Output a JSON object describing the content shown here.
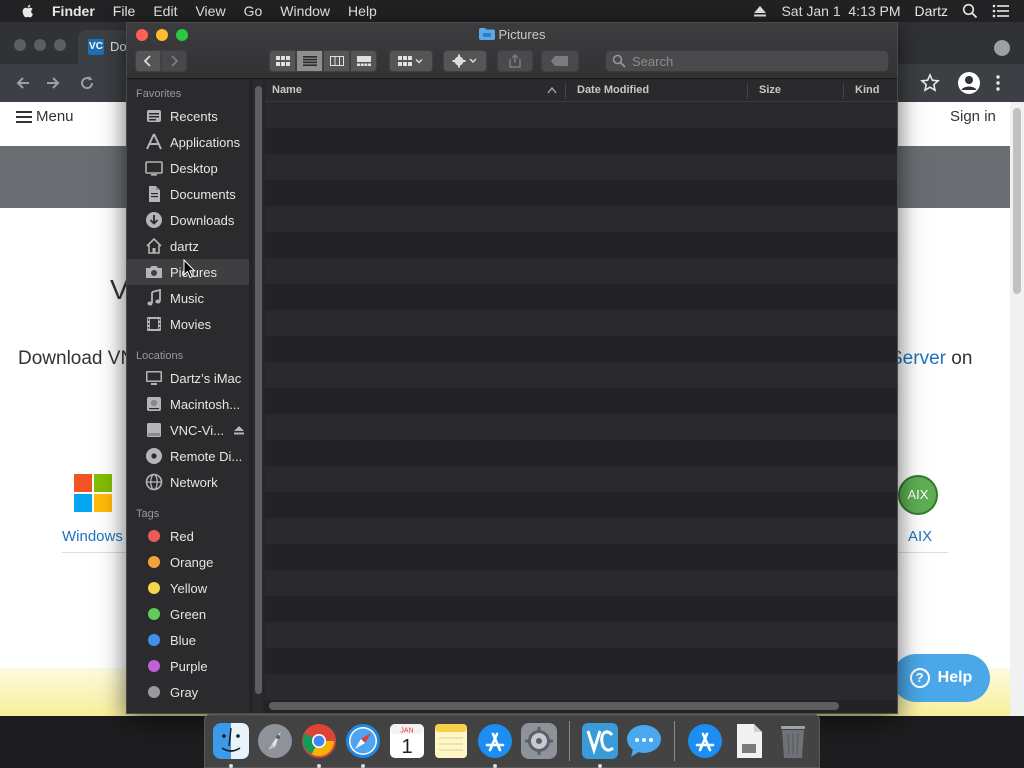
{
  "menubar": {
    "app_name": "Finder",
    "menus": [
      "File",
      "Edit",
      "View",
      "Go",
      "Window",
      "Help"
    ],
    "datetime": "Sat Jan 1  4:13 PM",
    "user": "Dartz"
  },
  "browser": {
    "tab_favicon": "VC",
    "tab_title": "Do",
    "site_menu_label": "Menu",
    "sign_in": "Sign in",
    "hero_partial": "V",
    "download_left": "Download VN",
    "download_right_highlight": "Server",
    "download_right_tail": " on",
    "windows_label": "Windows",
    "aix_logo": "AIX",
    "aix_label": "AIX",
    "help_q": "?",
    "help_label": "Help"
  },
  "finder": {
    "title": "Pictures",
    "search_placeholder": "Search",
    "sidebar": {
      "favorites_header": "Favorites",
      "favorites": [
        {
          "label": "Recents",
          "icon": "recents-icon"
        },
        {
          "label": "Applications",
          "icon": "applications-icon"
        },
        {
          "label": "Desktop",
          "icon": "desktop-icon"
        },
        {
          "label": "Documents",
          "icon": "documents-icon"
        },
        {
          "label": "Downloads",
          "icon": "downloads-icon"
        },
        {
          "label": "dartz",
          "icon": "home-icon"
        },
        {
          "label": "Pictures",
          "icon": "camera-icon",
          "selected": true
        },
        {
          "label": "Music",
          "icon": "music-icon"
        },
        {
          "label": "Movies",
          "icon": "movies-icon"
        }
      ],
      "locations_header": "Locations",
      "locations": [
        {
          "label": "Dartz’s iMac",
          "icon": "computer-icon"
        },
        {
          "label": "Macintosh...",
          "icon": "disk-icon"
        },
        {
          "label": "VNC-Vi...",
          "icon": "drive-icon"
        },
        {
          "label": "Remote Di...",
          "icon": "remote-disc-icon"
        },
        {
          "label": "Network",
          "icon": "network-icon"
        }
      ],
      "tags_header": "Tags",
      "tags": [
        {
          "label": "Red",
          "color": "#ec5a58"
        },
        {
          "label": "Orange",
          "color": "#f3a33b"
        },
        {
          "label": "Yellow",
          "color": "#f4d64a"
        },
        {
          "label": "Green",
          "color": "#5ccc5a"
        },
        {
          "label": "Blue",
          "color": "#3d8ff0"
        },
        {
          "label": "Purple",
          "color": "#bf5fd9"
        },
        {
          "label": "Gray",
          "color": "#9a9a9c"
        }
      ]
    },
    "columns": [
      "Name",
      "Date Modified",
      "Size",
      "Kind"
    ]
  },
  "dock_apps": [
    "finder-icon",
    "launchpad-icon",
    "chrome-icon",
    "safari-icon",
    "calendar-icon",
    "notes-icon",
    "app-store-icon",
    "system-preferences-icon",
    "vnc-viewer-icon",
    "messages-icon",
    "app-store-download-icon",
    "file-icon",
    "trash-icon"
  ],
  "calendar_month": "JAN",
  "calendar_day": "1"
}
